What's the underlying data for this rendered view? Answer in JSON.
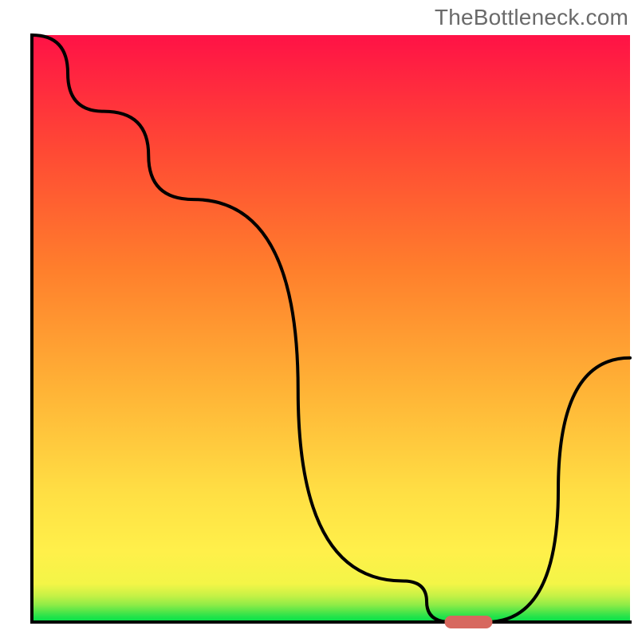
{
  "watermark": "TheBottleneck.com",
  "chart_data": {
    "type": "line",
    "title": "",
    "xlabel": "",
    "ylabel": "",
    "xlim": [
      0,
      100
    ],
    "ylim": [
      0,
      100
    ],
    "grid": false,
    "legend": false,
    "series": [
      {
        "name": "bottleneck-curve",
        "x": [
          0,
          12,
          27,
          62,
          70,
          76,
          100
        ],
        "y": [
          100,
          87,
          72,
          7,
          0,
          0,
          45
        ]
      }
    ],
    "marker": {
      "name": "optimal-range",
      "x_center": 73,
      "y": 0,
      "width": 8,
      "color": "#d7685f"
    },
    "gradient_stops": [
      {
        "pos": 0.0,
        "color": "#00e24a"
      },
      {
        "pos": 0.01,
        "color": "#27e34a"
      },
      {
        "pos": 0.02,
        "color": "#5de748"
      },
      {
        "pos": 0.03,
        "color": "#92ec47"
      },
      {
        "pos": 0.045,
        "color": "#c6f146"
      },
      {
        "pos": 0.065,
        "color": "#f3f547"
      },
      {
        "pos": 0.12,
        "color": "#fff04a"
      },
      {
        "pos": 0.22,
        "color": "#ffdf44"
      },
      {
        "pos": 0.4,
        "color": "#ffb236"
      },
      {
        "pos": 0.6,
        "color": "#ff7f2c"
      },
      {
        "pos": 0.8,
        "color": "#ff4a34"
      },
      {
        "pos": 1.0,
        "color": "#ff1246"
      }
    ],
    "annotations": []
  }
}
